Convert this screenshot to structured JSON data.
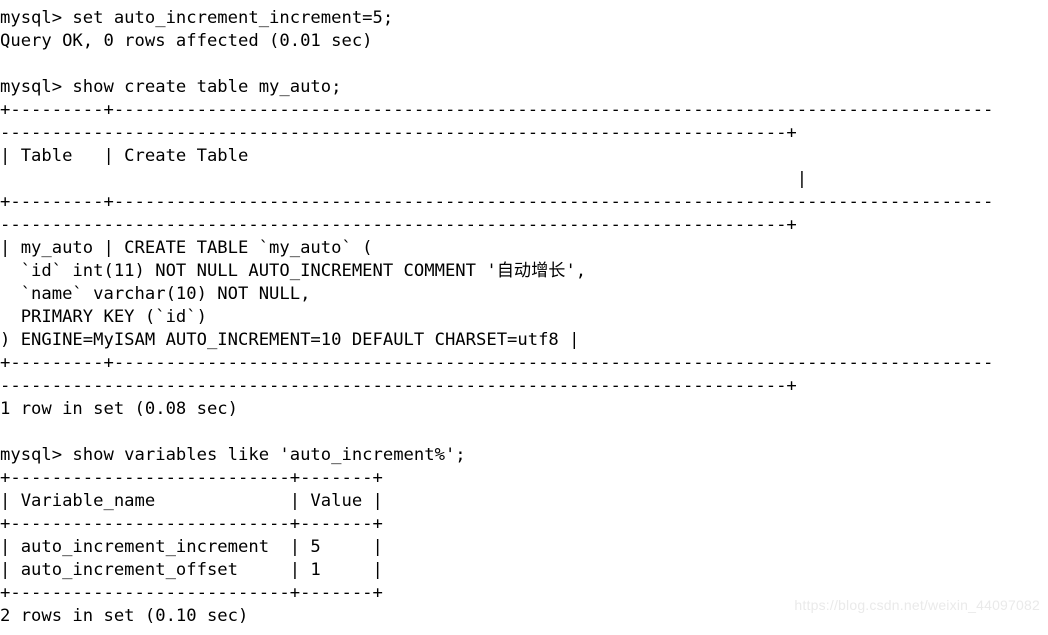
{
  "terminal": {
    "prompt": "mysql>",
    "background_color": "#ffffff",
    "text_color": "#000000",
    "lines": [
      "mysql> set auto_increment_increment=5;",
      "Query OK, 0 rows affected (0.01 sec)",
      "",
      "mysql> show create table my_auto;",
      "+---------+-------------------------------------------------------------------------------------",
      "----------------------------------------------------------------------------+",
      "| Table   | Create Table",
      "                                                                             |",
      "+---------+-------------------------------------------------------------------------------------",
      "----------------------------------------------------------------------------+",
      "| my_auto | CREATE TABLE `my_auto` (",
      "  `id` int(11) NOT NULL AUTO_INCREMENT COMMENT '自动增长',",
      "  `name` varchar(10) NOT NULL,",
      "  PRIMARY KEY (`id`)",
      ") ENGINE=MyISAM AUTO_INCREMENT=10 DEFAULT CHARSET=utf8 |",
      "+---------+-------------------------------------------------------------------------------------",
      "----------------------------------------------------------------------------+",
      "1 row in set (0.08 sec)",
      "",
      "mysql> show variables like 'auto_increment%';",
      "+---------------------------+-------+",
      "| Variable_name             | Value |",
      "+---------------------------+-------+",
      "| auto_increment_increment  | 5     |",
      "| auto_increment_offset     | 1     |",
      "+---------------------------+-------+",
      "2 rows in set (0.10 sec)"
    ],
    "commands": [
      {
        "prompt": "mysql>",
        "sql": "set auto_increment_increment=5;",
        "result": "Query OK, 0 rows affected (0.01 sec)"
      },
      {
        "prompt": "mysql>",
        "sql": "show create table my_auto;",
        "result": "1 row in set (0.08 sec)"
      },
      {
        "prompt": "mysql>",
        "sql": "show variables like 'auto_increment%';",
        "result": "2 rows in set (0.10 sec)"
      }
    ],
    "create_table_result": {
      "headers": [
        "Table",
        "Create Table"
      ],
      "table_name": "my_auto",
      "ddl_lines": [
        "CREATE TABLE `my_auto` (",
        "  `id` int(11) NOT NULL AUTO_INCREMENT COMMENT '自动增长',",
        "  `name` varchar(10) NOT NULL,",
        "  PRIMARY KEY (`id`)",
        ") ENGINE=MyISAM AUTO_INCREMENT=10 DEFAULT CHARSET=utf8"
      ],
      "footer": "1 row in set (0.08 sec)"
    },
    "variables_result": {
      "headers": [
        "Variable_name",
        "Value"
      ],
      "rows": [
        [
          "auto_increment_increment",
          "5"
        ],
        [
          "auto_increment_offset",
          "1"
        ]
      ],
      "footer": "2 rows in set (0.10 sec)"
    }
  },
  "watermark": {
    "text": "https://blog.csdn.net/weixin_44097082",
    "color": "#eaeaea"
  }
}
